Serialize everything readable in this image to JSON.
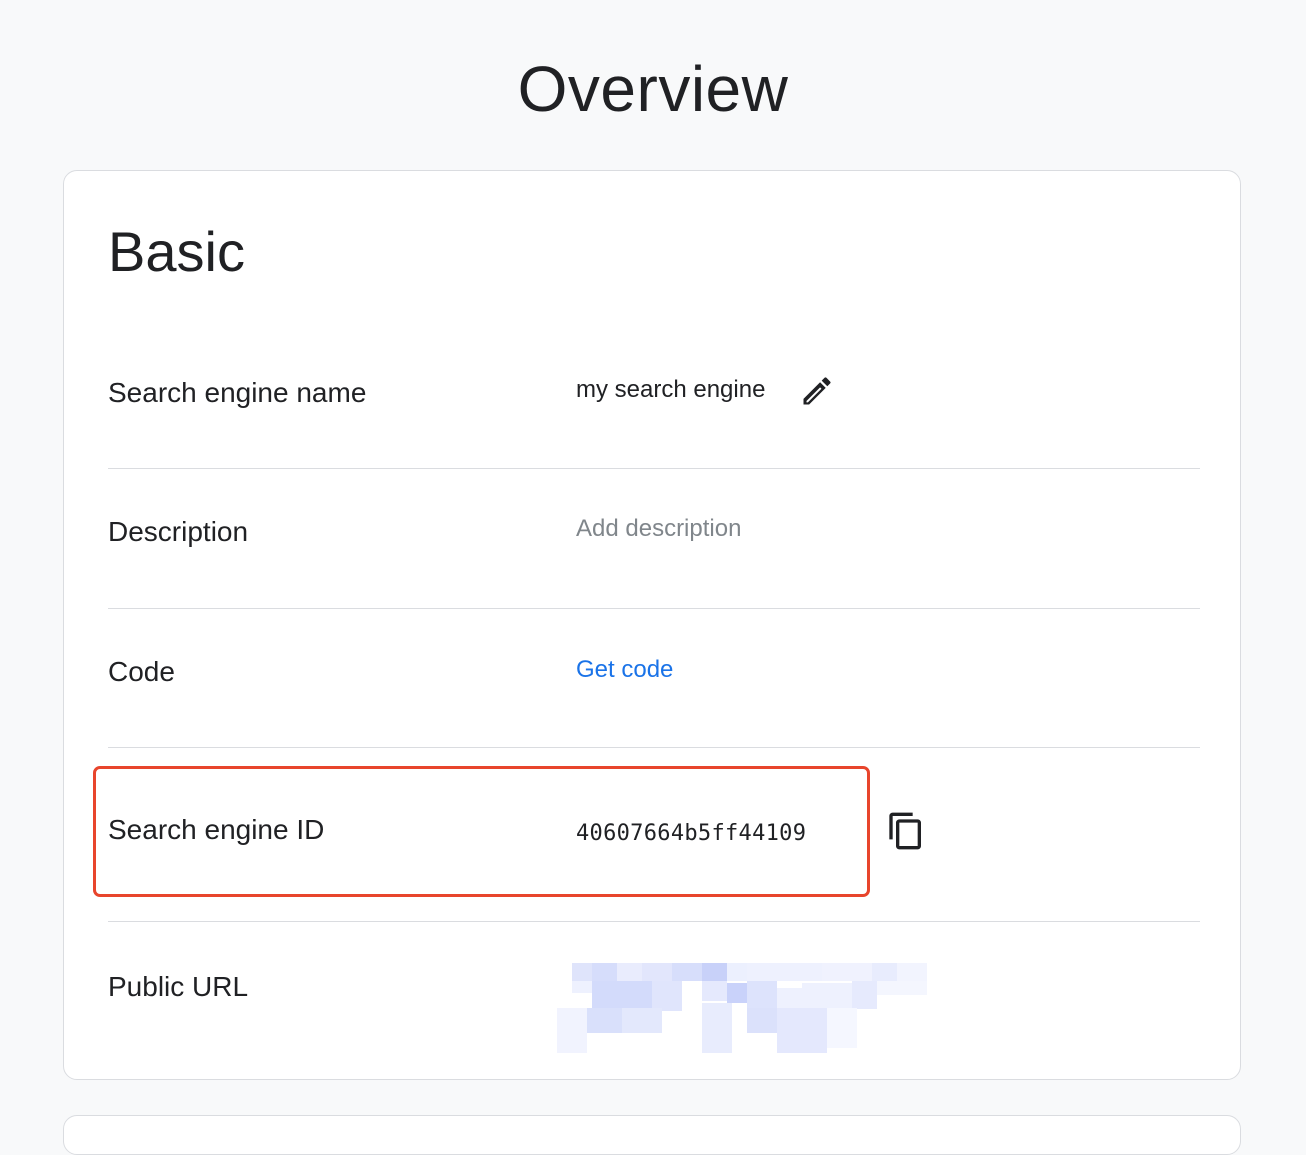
{
  "page": {
    "title": "Overview"
  },
  "basic": {
    "heading": "Basic",
    "rows": {
      "name": {
        "label": "Search engine name",
        "value": "my search engine",
        "action_icon": "pencil-edit-icon"
      },
      "description": {
        "label": "Description",
        "placeholder": "Add description"
      },
      "code": {
        "label": "Code",
        "link": "Get code"
      },
      "engine_id": {
        "label": "Search engine ID",
        "value": "40607664b5ff44109",
        "action_icon": "copy-icon"
      },
      "public_url": {
        "label": "Public URL",
        "value_state": "redacted (pixelated)"
      }
    }
  },
  "colors": {
    "background": "#f8f9fa",
    "card": "#ffffff",
    "divider": "#dadce0",
    "link": "#1a73e8",
    "placeholder": "#80868b",
    "highlight": "#e8452c",
    "text": "#202124"
  }
}
